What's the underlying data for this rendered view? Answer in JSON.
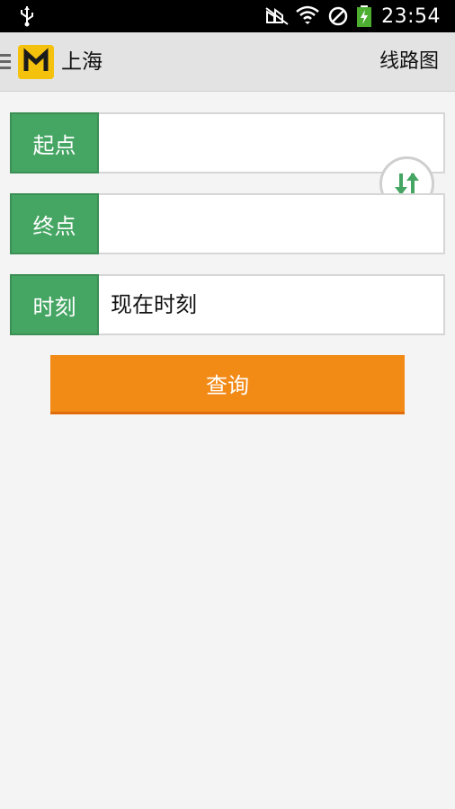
{
  "status_bar": {
    "time": "23:54",
    "icons": [
      "usb-icon",
      "mute-icon",
      "wifi-icon",
      "block-icon",
      "battery-charging-icon"
    ]
  },
  "action_bar": {
    "city": "上海",
    "map_link": "线路图",
    "icons": [
      "menu-icon",
      "metro-logo-icon"
    ]
  },
  "form": {
    "start_label": "起点",
    "start_value": "",
    "end_label": "终点",
    "end_value": "",
    "time_label": "时刻",
    "time_value": "现在时刻",
    "swap_icon": "swap-arrows-icon",
    "query_label": "查询"
  },
  "colors": {
    "label_green": "#45a563",
    "query_orange": "#f28a16",
    "logo_yellow": "#f4c20d"
  }
}
